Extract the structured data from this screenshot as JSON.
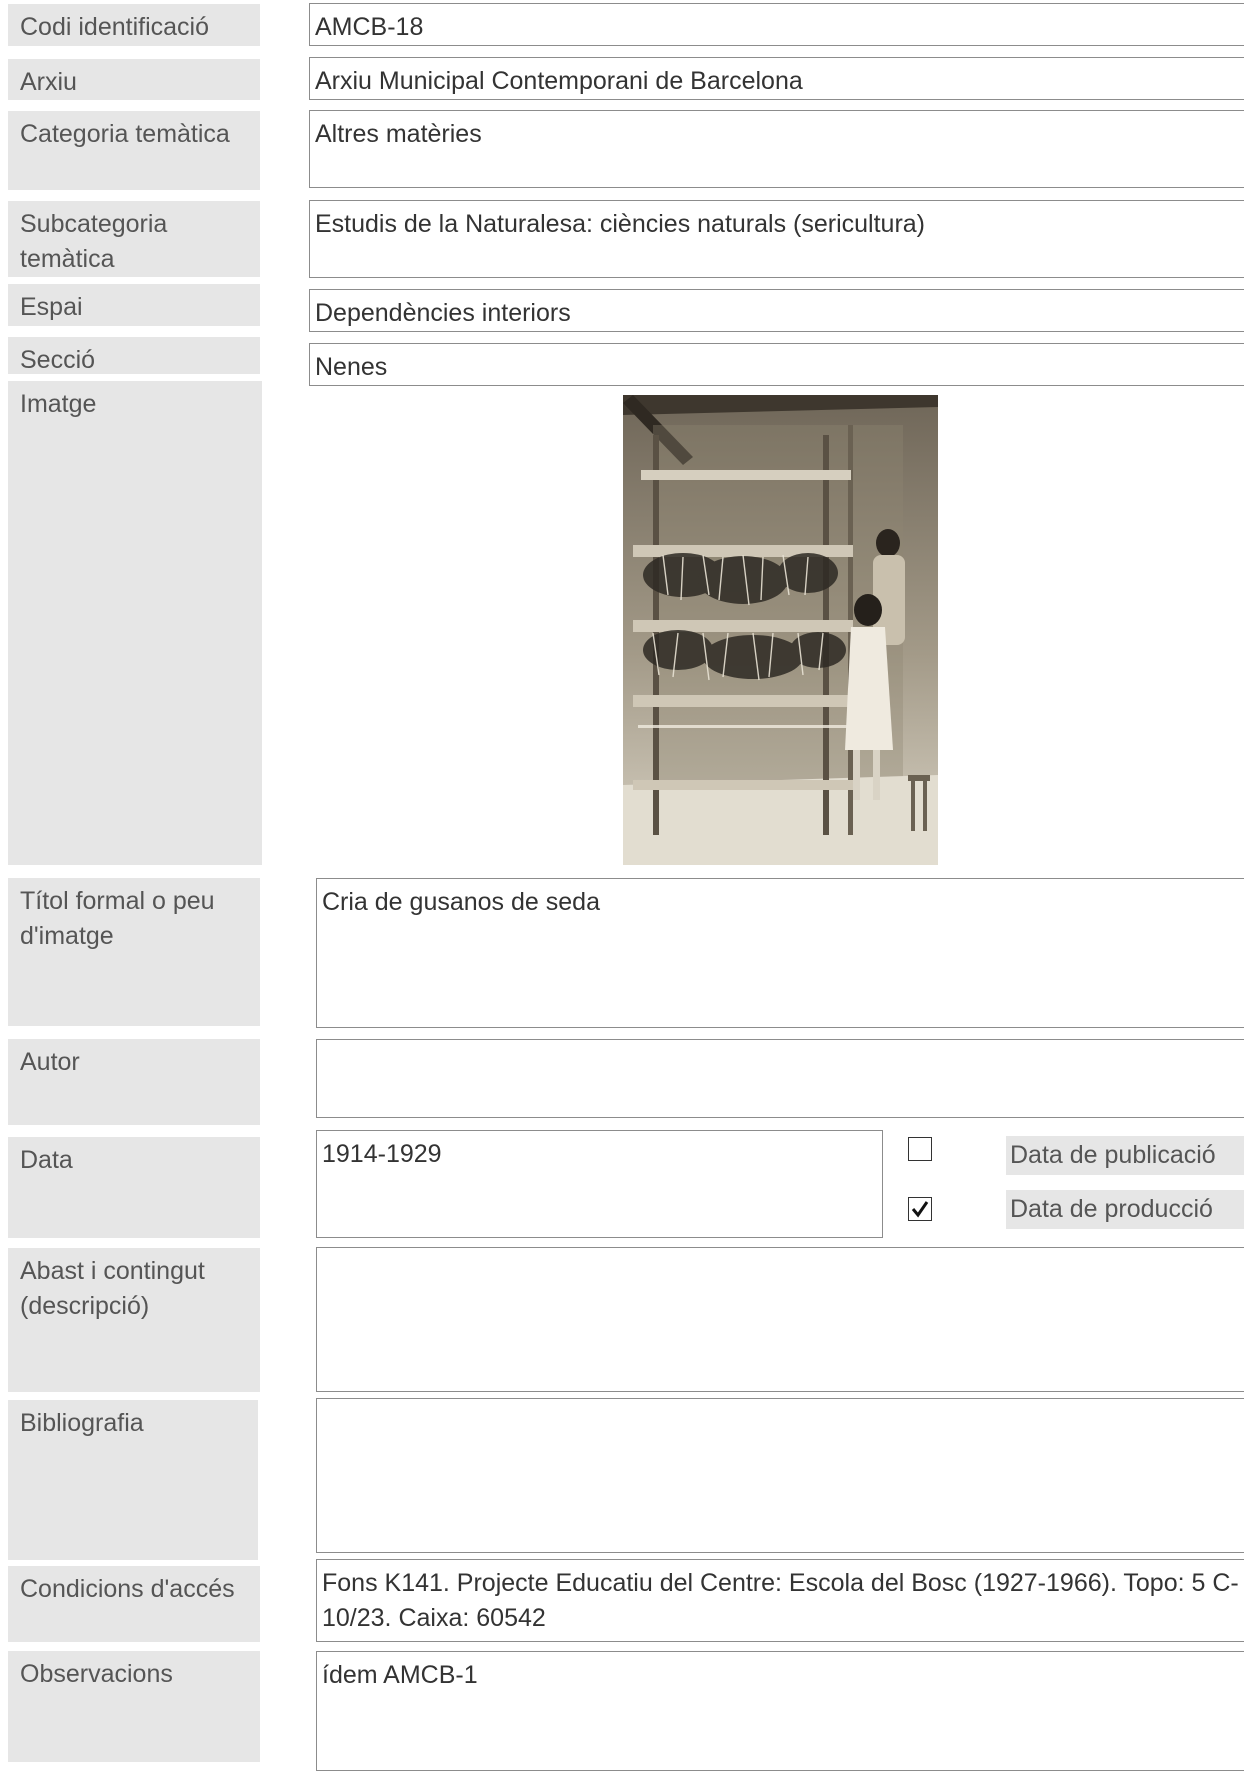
{
  "fields": {
    "codi": {
      "label": "Codi identificació",
      "value": "AMCB-18"
    },
    "arxiu": {
      "label": "Arxiu",
      "value": "Arxiu Municipal Contemporani de Barcelona"
    },
    "categoria": {
      "label": "Categoria temàtica",
      "value": "Altres matèries"
    },
    "subcategoria": {
      "label": "Subcategoria temàtica",
      "value": "Estudis de la Naturalesa: ciències naturals (sericultura)"
    },
    "espai": {
      "label": "Espai",
      "value": "Dependències interiors"
    },
    "seccio": {
      "label": "Secció",
      "value": "Nenes"
    },
    "imatge": {
      "label": "Imatge"
    },
    "titol": {
      "label": "Títol formal o peu d'imatge",
      "value": "Cria de gusanos de seda"
    },
    "autor": {
      "label": "Autor",
      "value": ""
    },
    "data": {
      "label": "Data",
      "value": "1914-1929",
      "publicacio": {
        "label": "Data de publicació",
        "checked": false
      },
      "produccio": {
        "label": "Data de producció",
        "checked": true
      }
    },
    "abast": {
      "label": "Abast i contingut (descripció)",
      "value": ""
    },
    "bibliografia": {
      "label": "Bibliografia",
      "value": ""
    },
    "condicions": {
      "label": "Condicions d'accés",
      "value": "Fons K141. Projecte Educatiu del Centre: Escola del Bosc (1927-1966). Topo: 5 C-10/23. Caixa: 60542"
    },
    "observacions": {
      "label": "Observacions",
      "value": "ídem AMCB-1"
    }
  },
  "colors": {
    "label_bg": "#e6e6e6",
    "label_text": "#555555",
    "border": "#8c8c8c",
    "photo_sepia": "#a39a88"
  }
}
